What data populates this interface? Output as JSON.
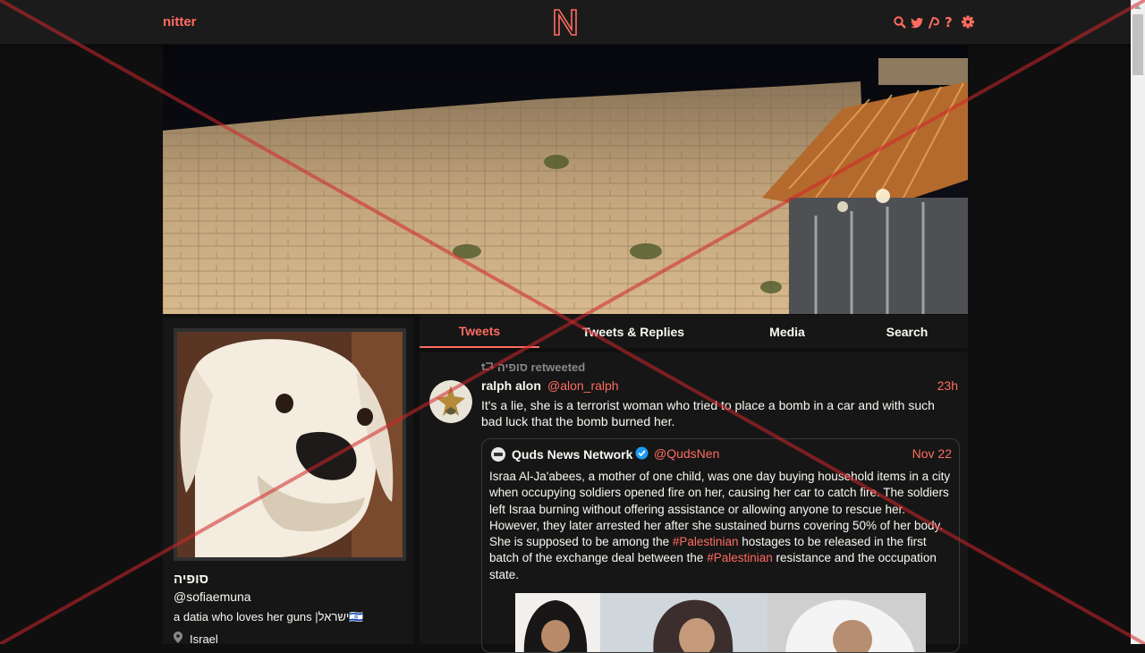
{
  "nav": {
    "brand": "nitter",
    "logo_letter": "N",
    "icons": [
      "search-icon",
      "twitter-bird-icon",
      "rss-icon",
      "help-icon",
      "gear-icon"
    ]
  },
  "colors": {
    "accent": "#ff6c60",
    "bg": "#0f0f0f",
    "panel": "#161616",
    "navbar": "#1b1b1b",
    "muted": "#888889"
  },
  "profile": {
    "fullname": "סופיה",
    "username": "@sofiaemuna",
    "bio": "a datia who loves her guns |ישראל🇮🇱",
    "location": "Israel"
  },
  "tabs": [
    {
      "label": "Tweets",
      "active": true
    },
    {
      "label": "Tweets & Replies",
      "active": false
    },
    {
      "label": "Media",
      "active": false
    },
    {
      "label": "Search",
      "active": false
    }
  ],
  "tweet": {
    "retweet_header": "סופיה retweeted",
    "fullname": "ralph alon",
    "username": "@alon_ralph",
    "date": "23h",
    "text": "It's a lie, she is a terrorist woman who tried to place a bomb in a car and with such bad luck that the bomb burned her.",
    "quote": {
      "fullname": "Quds News Network",
      "verified": true,
      "username": "@QudsNen",
      "date": "Nov 22",
      "text_1": "Israa  Al-Ja'abees, a mother of one child, was one day buying household items in a city when occupying soldiers opened fire on her, causing her car to catch fire. The soldiers left Israa burning without offering assistance or allowing anyone to rescue her. However, they later arrested her after she sustained burns covering 50% of her body. She is supposed to be among the ",
      "hashtag_1": "#Palestinian",
      "text_2": " hostages to be released in the first batch of the exchange deal between the ",
      "hashtag_2": "#Palestinian",
      "text_3": " resistance and the occupation state."
    }
  }
}
